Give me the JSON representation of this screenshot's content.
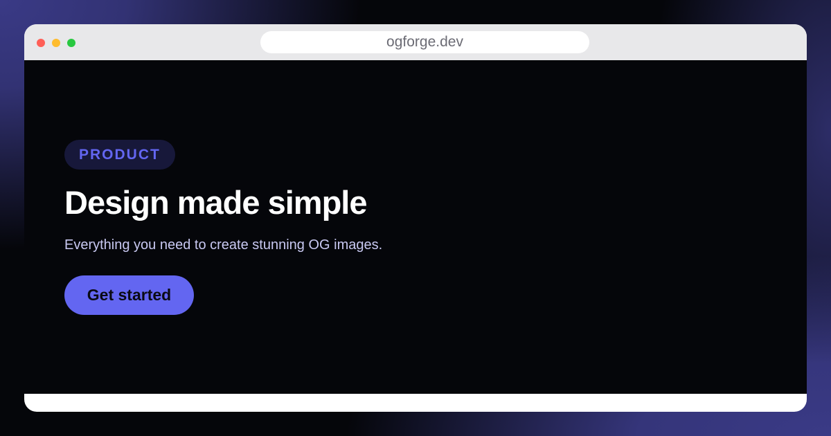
{
  "browser": {
    "url": "ogforge.dev",
    "controls": [
      {
        "name": "close",
        "color": "#ff5f57"
      },
      {
        "name": "minimize",
        "color": "#febc2e"
      },
      {
        "name": "maximize",
        "color": "#28c840"
      }
    ]
  },
  "hero": {
    "badge": "PRODUCT",
    "title": "Design made simple",
    "subtitle": "Everything you need to create stunning OG images.",
    "cta_label": "Get started"
  },
  "colors": {
    "accent": "#6366f1",
    "badge_text": "#6366f1",
    "content_background": "#05060a",
    "backdrop": "#3a3a86"
  }
}
